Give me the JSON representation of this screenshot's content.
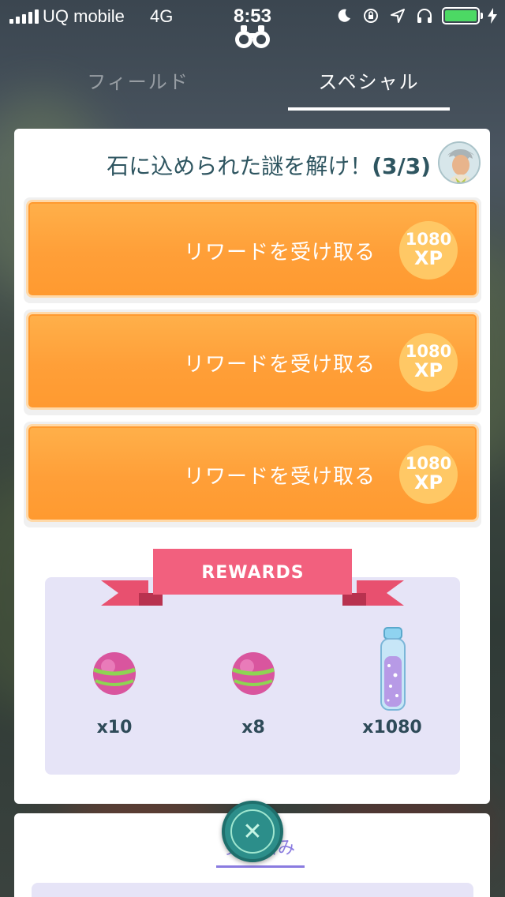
{
  "status_bar": {
    "carrier": "UQ mobile",
    "network": "4G",
    "time": "8:53",
    "icons": [
      "moon-icon",
      "orientation-lock-icon",
      "location-arrow-icon",
      "headphones-icon",
      "battery-icon",
      "charging-icon"
    ]
  },
  "tabs": {
    "field": "フィールド",
    "special": "スペシャル"
  },
  "quest": {
    "title": "石に込められた謎を解け！",
    "progress": "(3/3)",
    "tasks": [
      {
        "label": "リワードを受け取る",
        "xp_amount": "1080",
        "xp_unit": "XP"
      },
      {
        "label": "リワードを受け取る",
        "xp_amount": "1080",
        "xp_unit": "XP"
      },
      {
        "label": "リワードを受け取る",
        "xp_amount": "1080",
        "xp_unit": "XP"
      }
    ]
  },
  "rewards": {
    "banner": "REWARDS",
    "items": [
      {
        "icon": "pink-ball-icon",
        "quantity": "x10"
      },
      {
        "icon": "pink-ball-icon",
        "quantity": "x8"
      },
      {
        "icon": "stardust-vial-icon",
        "quantity": "x1080"
      }
    ]
  },
  "bottom": {
    "completed_tab": "完了済み",
    "close_icon": "close-icon"
  },
  "colors": {
    "accent_orange": "#ff9f38",
    "xp_badge": "#ffc865",
    "ribbon_pink": "#f25c80",
    "rewards_panel": "#e6e4f7",
    "title_text": "#2e5560",
    "close_teal": "#2c8e8a",
    "battery_green": "#4cd964"
  }
}
